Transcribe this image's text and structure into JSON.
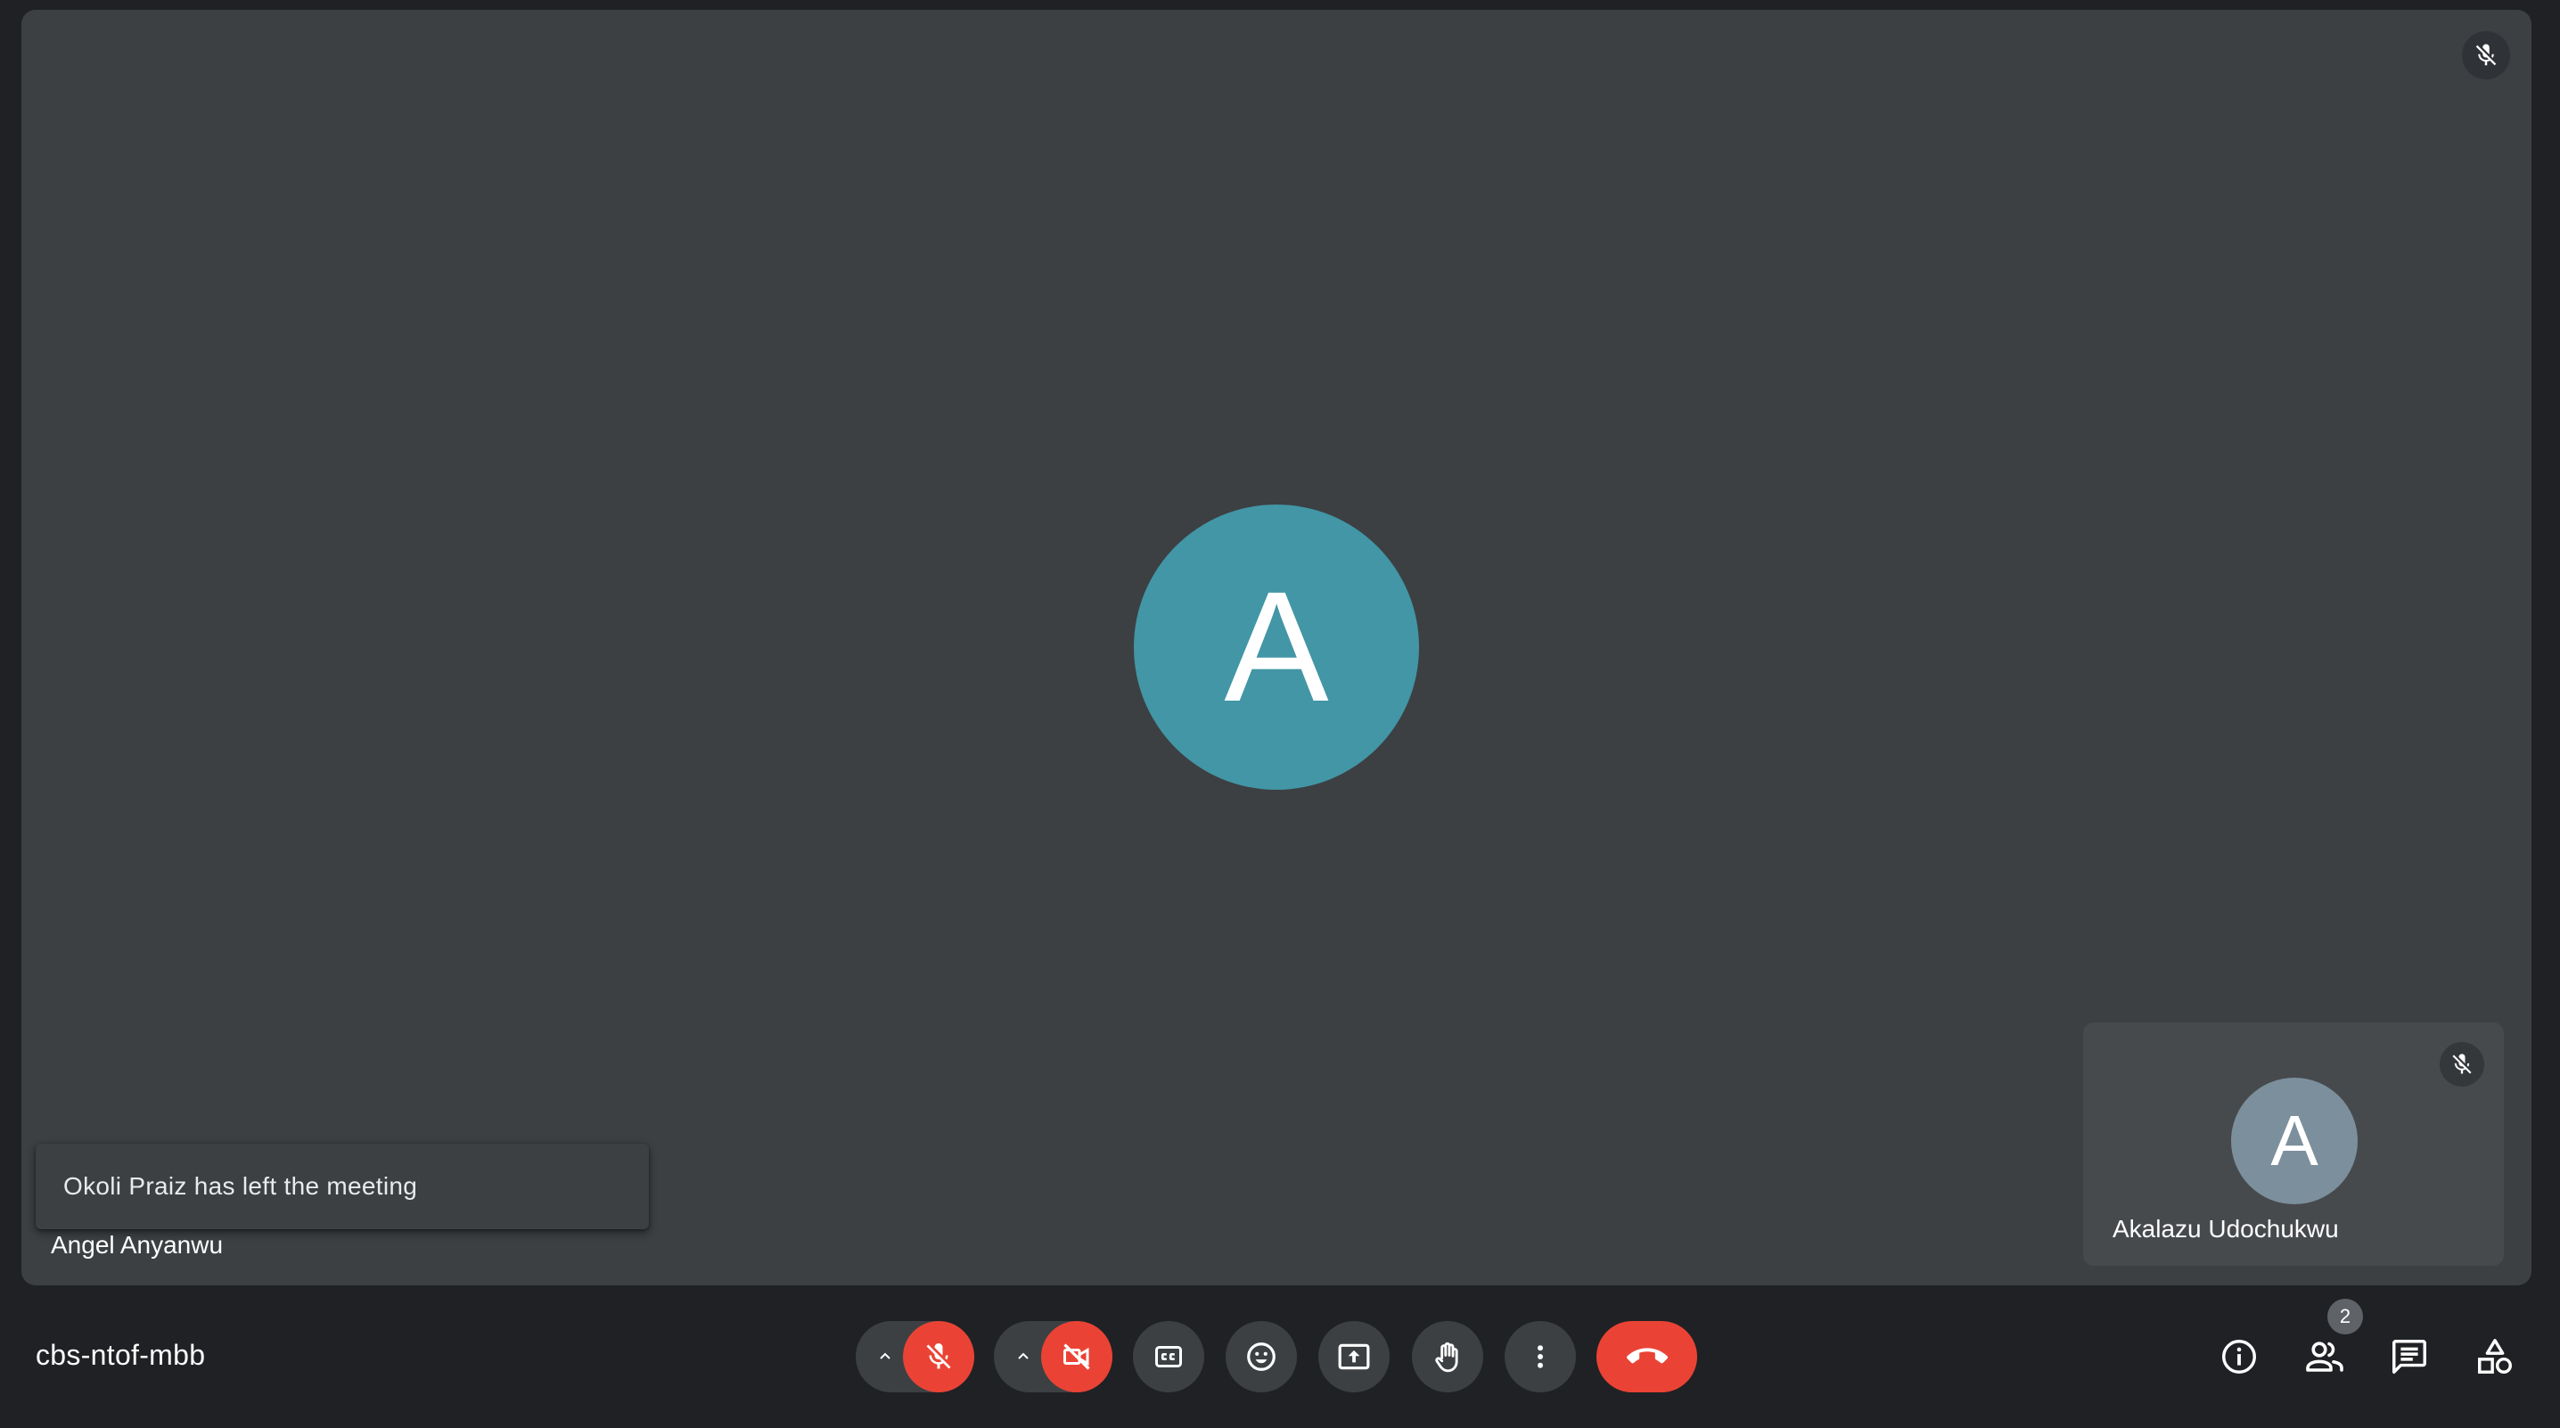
{
  "main_participant": {
    "avatar_letter": "A",
    "name": "Angel Anyanwu",
    "avatar_color": "#4296a6"
  },
  "notification": {
    "text": "Okoli Praiz has left the meeting"
  },
  "self_tile": {
    "avatar_letter": "A",
    "name": "Akalazu Udochukwu",
    "avatar_color": "#7c8f9c"
  },
  "meeting": {
    "code": "cbs-ntof-mbb"
  },
  "controls": {
    "microphone": "mic-off-icon",
    "camera": "videocam-off-icon",
    "captions": "closed-captions-icon",
    "reactions": "emoji-icon",
    "present": "present-screen-icon",
    "raise_hand": "hand-icon",
    "more": "more-vert-icon",
    "leave": "call-end-icon"
  },
  "side_controls": {
    "people_count": "2"
  },
  "colors": {
    "stage_background": "#3c4043",
    "page_background": "#202124",
    "danger_red": "#ea4335"
  }
}
